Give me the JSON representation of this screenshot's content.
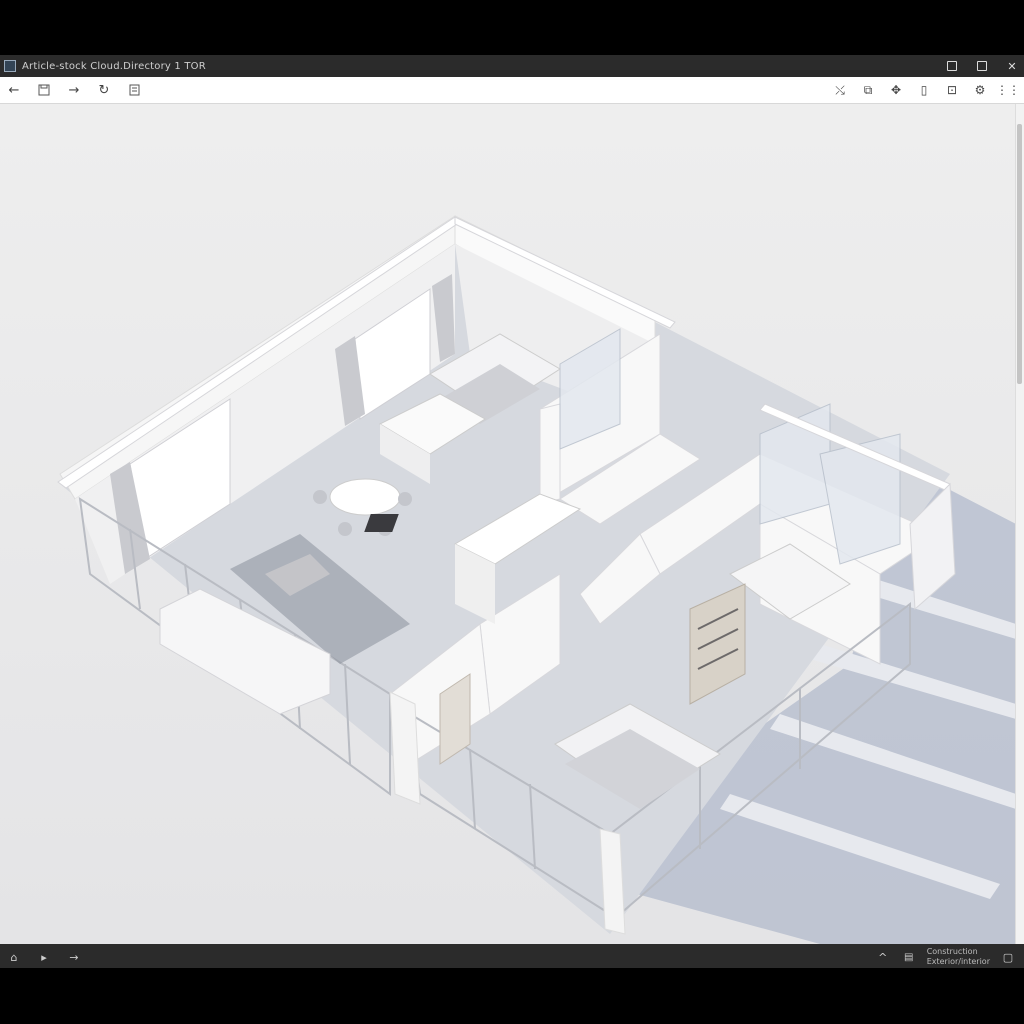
{
  "window": {
    "title": "Article-stock Cloud.Directory 1 TOR",
    "controls": [
      "minimize-icon",
      "maximize-icon",
      "close-icon"
    ]
  },
  "toolbar": {
    "left_icons": [
      "back-arrow-icon",
      "save-icon",
      "forward-arrow-icon",
      "refresh-icon",
      "document-icon"
    ],
    "right_icons": [
      "share-icon",
      "copy-icon",
      "grid-move-icon",
      "clipboard-icon",
      "export-icon",
      "settings-icon",
      "apps-grid-icon"
    ]
  },
  "status": {
    "left_icons": [
      "home-icon",
      "play-icon",
      "arrow-icon"
    ],
    "right_icons": [
      "collapse-icon",
      "layers-icon"
    ],
    "text_line1": "Construction",
    "text_line2": "Exterior/interior",
    "panel_icon": "panel-icon"
  },
  "colors": {
    "chrome_dark": "#2b2b2b",
    "viewport_bg": "#ececec",
    "wall": "#f7f7f7",
    "floor": "#d9dbe0",
    "shadow": "#a9b2c7"
  }
}
